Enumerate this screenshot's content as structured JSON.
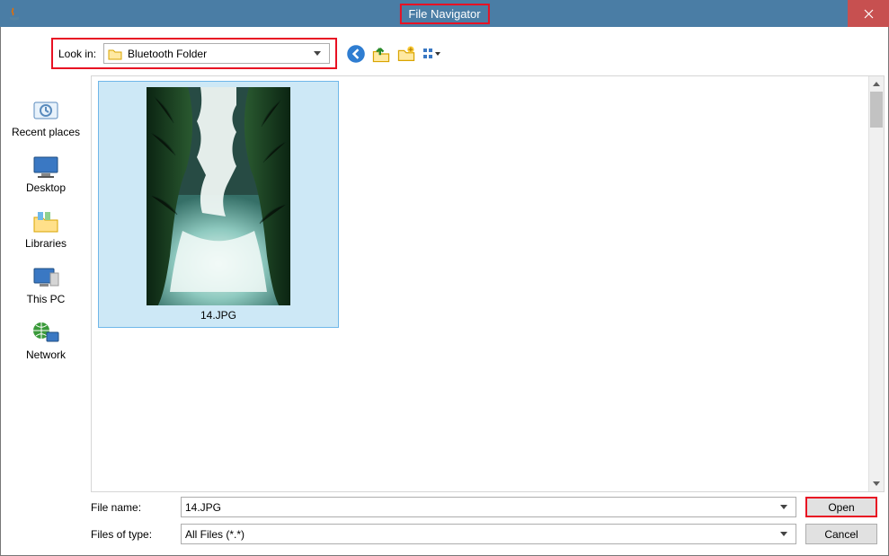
{
  "window": {
    "title": "File Navigator"
  },
  "toolbar": {
    "lookin_label": "Look in:",
    "lookin_value": "Bluetooth Folder",
    "icons": {
      "back": "back-icon",
      "up": "up-one-level-icon",
      "new_folder": "new-folder-icon",
      "view": "view-menu-icon"
    }
  },
  "places": [
    {
      "label": "Recent places"
    },
    {
      "label": "Desktop"
    },
    {
      "label": "Libraries"
    },
    {
      "label": "This PC"
    },
    {
      "label": "Network"
    }
  ],
  "pane": {
    "items": [
      {
        "name": "14.JPG",
        "selected": true
      }
    ]
  },
  "bottom": {
    "filename_label": "File name:",
    "filename_value": "14.JPG",
    "filetype_label": "Files of type:",
    "filetype_value": "All Files (*.*)",
    "open_label": "Open",
    "cancel_label": "Cancel"
  }
}
